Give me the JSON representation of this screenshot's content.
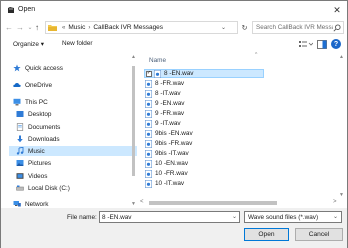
{
  "window": {
    "title": "Open",
    "close": "✕"
  },
  "address": {
    "prefix": "«",
    "segments": [
      "Music",
      "CallBack IVR Messages"
    ],
    "separator": "›"
  },
  "search": {
    "placeholder": "Search CallBack IVR Messages"
  },
  "toolbar": {
    "organize": "Organize ▾",
    "new_folder": "New folder",
    "help": "?"
  },
  "navpane": {
    "items": [
      {
        "label": "Quick access",
        "icon": "star-icon"
      },
      {
        "label": "OneDrive",
        "icon": "cloud-icon"
      },
      {
        "label": "This PC",
        "icon": "computer-icon"
      },
      {
        "label": "Desktop",
        "icon": "desktop-icon"
      },
      {
        "label": "Documents",
        "icon": "documents-icon"
      },
      {
        "label": "Downloads",
        "icon": "downloads-icon"
      },
      {
        "label": "Music",
        "icon": "music-icon"
      },
      {
        "label": "Pictures",
        "icon": "pictures-icon"
      },
      {
        "label": "Videos",
        "icon": "videos-icon"
      },
      {
        "label": "Local Disk (C:)",
        "icon": "disk-icon"
      },
      {
        "label": "Network",
        "icon": "network-icon"
      }
    ]
  },
  "filelist": {
    "column": "Name",
    "files": [
      "8 -EN.wav",
      "8 -FR.wav",
      "8 -IT.wav",
      "9 -EN.wav",
      "9 -FR.wav",
      "9 -IT.wav",
      "9bis -EN.wav",
      "9bis -FR.wav",
      "9bis -IT.wav",
      "10 -EN.wav",
      "10 -FR.wav",
      "10 -IT.wav"
    ],
    "selected_check": "✓"
  },
  "bottom": {
    "filename_label": "File name:",
    "filename_value": "8 -EN.wav",
    "filetype": "Wave sound files (*.wav)",
    "open": "Open",
    "cancel": "Cancel"
  }
}
